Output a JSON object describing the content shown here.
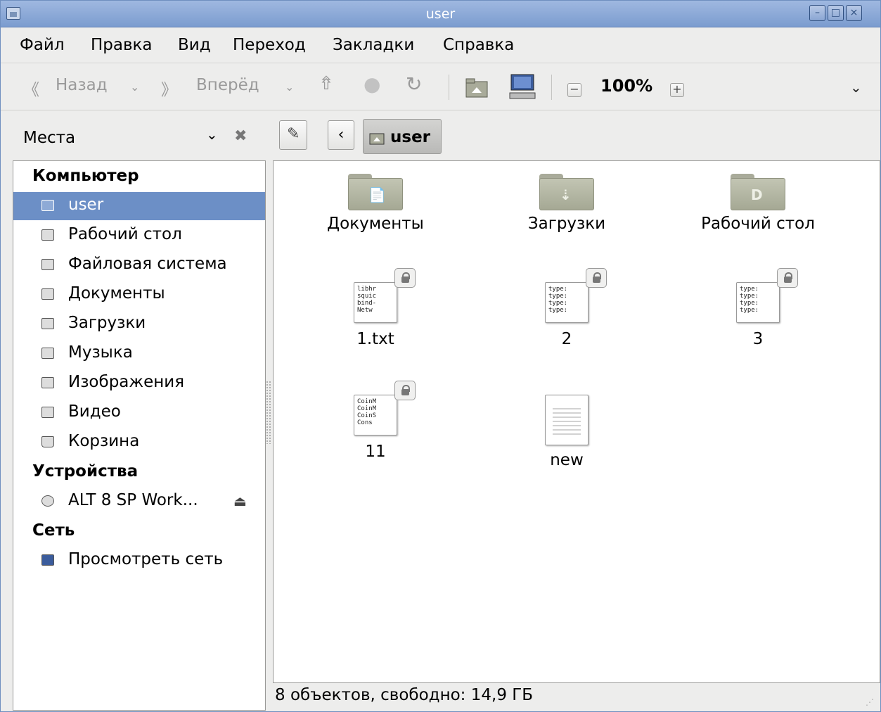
{
  "window": {
    "title": "user",
    "controls": {
      "minimize": "–",
      "maximize": "□",
      "close": "×"
    }
  },
  "menubar": [
    "Файл",
    "Правка",
    "Вид",
    "Переход",
    "Закладки",
    "Справка"
  ],
  "toolbar": {
    "back_label": "Назад",
    "forward_label": "Вперёд",
    "zoom_level": "100%"
  },
  "location": {
    "places_label": "Места",
    "current_folder": "user"
  },
  "sidebar": {
    "computer_heading": "Компьютер",
    "computer_items": [
      "user",
      "Рабочий стол",
      "Файловая система",
      "Документы",
      "Загрузки",
      "Музыка",
      "Изображения",
      "Видео",
      "Корзина"
    ],
    "devices_heading": "Устройства",
    "device_items": [
      "ALT 8 SP Work..."
    ],
    "network_heading": "Сеть",
    "network_items": [
      "Просмотреть сеть"
    ],
    "selected_item": "user"
  },
  "files": [
    {
      "name": "Документы",
      "type": "folder",
      "emblem": "📄"
    },
    {
      "name": "Загрузки",
      "type": "folder",
      "emblem": "⇣"
    },
    {
      "name": "Рабочий стол",
      "type": "folder",
      "emblem": "D"
    },
    {
      "name": "1.txt",
      "type": "text",
      "preview": "libhr\nsquic\nbind-\nNetw",
      "locked": true
    },
    {
      "name": "2",
      "type": "text",
      "preview": "type:\ntype:\ntype:\ntype:",
      "locked": true
    },
    {
      "name": "3",
      "type": "text",
      "preview": "type:\ntype:\ntype:\ntype:",
      "locked": true
    },
    {
      "name": "11",
      "type": "text",
      "preview": "CoinM\nCoinM\nCoinS\nCons",
      "locked": true
    },
    {
      "name": "new",
      "type": "blank",
      "locked": false
    }
  ],
  "status": "8 объектов, свободно: 14,9 ГБ",
  "colors": {
    "selection": "#6c8fc6",
    "titlebar": "#7b9ccf"
  }
}
